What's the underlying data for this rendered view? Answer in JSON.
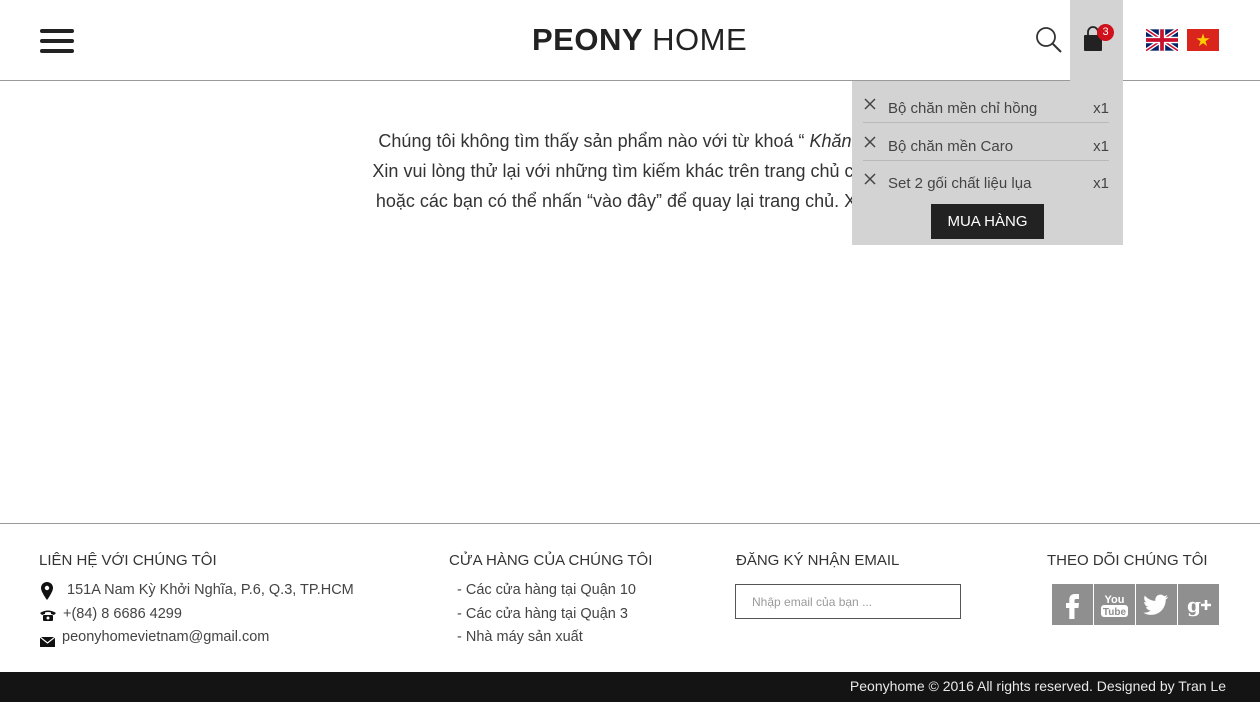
{
  "header": {
    "logo_bold": "PEONY",
    "logo_light": "HOME",
    "cart_count": "3",
    "icons": [
      "hamburger-menu-icon",
      "search-icon",
      "shopping-bag-icon",
      "uk-flag-icon",
      "vietnam-flag-icon"
    ]
  },
  "message": {
    "line1_prefix": "Chúng tôi không tìm thấy sản phẩm nào với từ khoá “ ",
    "line1_keyword": "Khăn trải",
    "line2": "Xin vui lòng thử lại với những tìm kiếm khác trên trang chủ của c",
    "line3": "hoặc các bạn có thể nhấn “vào đây” để quay lại trang chủ. Xin c"
  },
  "cart": {
    "items": [
      {
        "name": "Bộ chăn mền chỉ hồng",
        "qty": "x1"
      },
      {
        "name": "Bộ chăn mền Caro",
        "qty": "x1"
      },
      {
        "name": "Set 2 gối chất liệu lụa",
        "qty": "x1"
      }
    ],
    "buy_label": "MUA HÀNG"
  },
  "footer": {
    "contact": {
      "heading": "LIÊN HỆ VỚI CHÚNG TÔI",
      "address": "151A Nam Kỳ Khởi Nghĩa, P.6, Q.3, TP.HCM",
      "phone": "+(84) 8 6686 4299",
      "email": "peonyhomevietnam@gmail.com"
    },
    "stores": {
      "heading": "CỬA HÀNG CỦA CHÚNG TÔI",
      "items": [
        "- Các cửa hàng tại Quận 10",
        "- Các cửa hàng tại Quận 3",
        "- Nhà máy sản xuất"
      ]
    },
    "newsletter": {
      "heading": "ĐĂNG KÝ NHẬN EMAIL",
      "placeholder": "Nhập email của bạn ..."
    },
    "follow": {
      "heading": "THEO DÕI CHÚNG TÔI",
      "networks": [
        "facebook-icon",
        "youtube-icon",
        "twitter-icon",
        "google-plus-icon"
      ]
    },
    "copyright": "Peonyhome © 2016 All rights reserved. Designed by Tran Le"
  },
  "colors": {
    "badge": "#d0101b",
    "dropdown_bg": "#d3d3d3",
    "bottom_bar": "#141414",
    "social_bg": "#8f8f8f"
  }
}
